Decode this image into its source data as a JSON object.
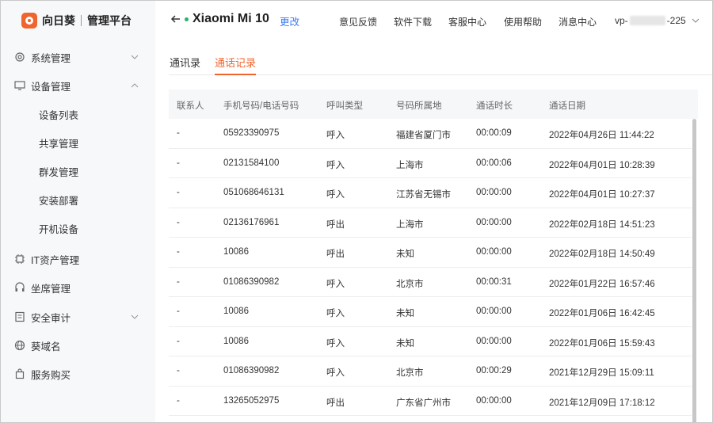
{
  "brand": {
    "name": "向日葵",
    "subtitle": "管理平台"
  },
  "sidebar": {
    "items": [
      {
        "label": "系统管理",
        "icon": "gear-icon",
        "expanded": false
      },
      {
        "label": "设备管理",
        "icon": "monitor-icon",
        "expanded": true,
        "children": [
          "设备列表",
          "共享管理",
          "群发管理",
          "安装部署",
          "开机设备"
        ]
      },
      {
        "label": "IT资产管理",
        "icon": "chip-icon"
      },
      {
        "label": "坐席管理",
        "icon": "headset-icon"
      },
      {
        "label": "安全审计",
        "icon": "audit-icon",
        "expanded": false
      },
      {
        "label": "葵域名",
        "icon": "globe-icon"
      },
      {
        "label": "服务购买",
        "icon": "bag-icon"
      }
    ]
  },
  "header": {
    "device_name": "Xiaomi Mi 10",
    "rename_label": "更改",
    "nav": [
      "意见反馈",
      "软件下载",
      "客服中心",
      "使用帮助",
      "消息中心"
    ],
    "account_prefix": "vp-",
    "account_suffix": "-225"
  },
  "tabs": [
    "通讯录",
    "通话记录"
  ],
  "active_tab": 1,
  "accent_color": "#f0642d",
  "link_color": "#3b7cf4",
  "table": {
    "columns": [
      "联系人",
      "手机号码/电话号码",
      "呼叫类型",
      "号码所属地",
      "通话时长",
      "通话日期"
    ],
    "rows": [
      [
        "-",
        "05923390975",
        "呼入",
        "福建省厦门市",
        "00:00:09",
        "2022年04月26日 11:44:22"
      ],
      [
        "-",
        "02131584100",
        "呼入",
        "上海市",
        "00:00:06",
        "2022年04月01日 10:28:39"
      ],
      [
        "-",
        "051068646131",
        "呼入",
        "江苏省无锡市",
        "00:00:00",
        "2022年04月01日 10:27:37"
      ],
      [
        "-",
        "02136176961",
        "呼出",
        "上海市",
        "00:00:00",
        "2022年02月18日 14:51:23"
      ],
      [
        "-",
        "10086",
        "呼出",
        "未知",
        "00:00:00",
        "2022年02月18日 14:50:49"
      ],
      [
        "-",
        "01086390982",
        "呼入",
        "北京市",
        "00:00:31",
        "2022年01月22日 16:57:46"
      ],
      [
        "-",
        "10086",
        "呼入",
        "未知",
        "00:00:00",
        "2022年01月06日 16:42:45"
      ],
      [
        "-",
        "10086",
        "呼入",
        "未知",
        "00:00:00",
        "2022年01月06日 15:59:43"
      ],
      [
        "-",
        "01086390982",
        "呼入",
        "北京市",
        "00:00:29",
        "2021年12月29日 15:09:11"
      ],
      [
        "-",
        "13265052975",
        "呼出",
        "广东省广州市",
        "00:00:00",
        "2021年12月09日 17:18:12"
      ]
    ]
  }
}
